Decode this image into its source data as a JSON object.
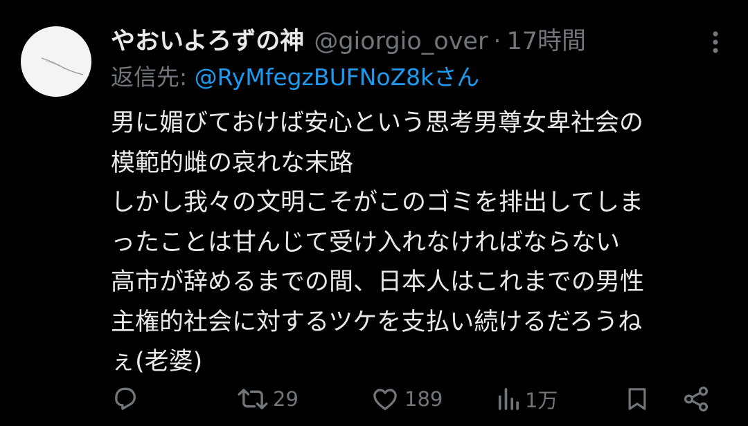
{
  "tweet": {
    "display_name": "やおいよろずの神",
    "handle": "@giorgio_over",
    "separator": "·",
    "timestamp": "17時間",
    "reply_prefix": "返信先: ",
    "reply_to": "@RyMfegzBUFNoZ8kさん",
    "body_lines": [
      "男に媚びておけば安心という思考男尊女卑社会の",
      "模範的雌の哀れな末路",
      "しかし我々の文明こそがこのゴミを排出してしま",
      "ったことは甘んじて受け入れなければならない",
      "高市が辞めるまでの間、日本人はこれまでの男性",
      "主権的社会に対するツケを支払い続けるだろうね",
      "ぇ(老婆)"
    ]
  },
  "actions": {
    "reply": {
      "icon": "reply-icon",
      "count": ""
    },
    "retweet": {
      "icon": "retweet-icon",
      "count": "29"
    },
    "like": {
      "icon": "heart-icon",
      "count": "189"
    },
    "views": {
      "icon": "views-icon",
      "count": "1万"
    },
    "bookmark": {
      "icon": "bookmark-icon",
      "count": ""
    },
    "share": {
      "icon": "share-icon",
      "count": ""
    }
  },
  "colors": {
    "background": "#000000",
    "text": "#e7e9ea",
    "muted": "#71767b",
    "link": "#1d9bf0"
  }
}
